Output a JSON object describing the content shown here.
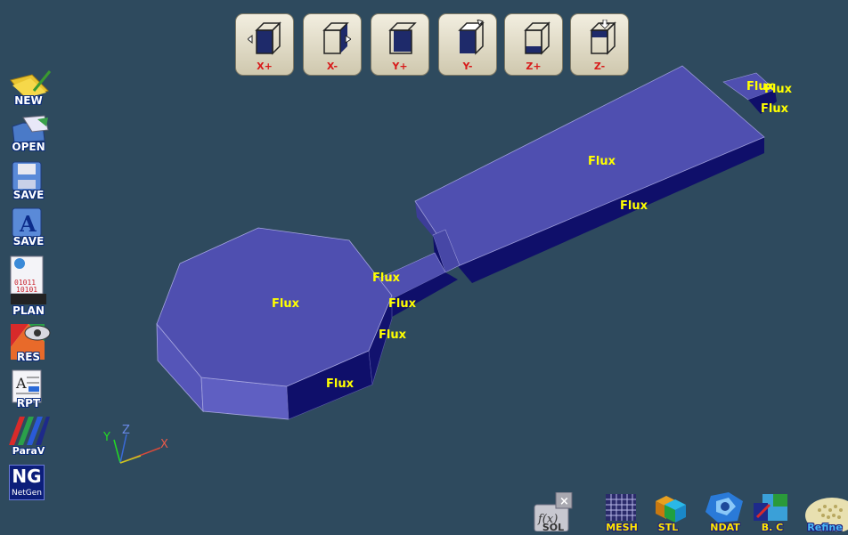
{
  "view_buttons": [
    {
      "label": "X+"
    },
    {
      "label": "X-"
    },
    {
      "label": "Y+"
    },
    {
      "label": "Y-"
    },
    {
      "label": "Z+"
    },
    {
      "label": "Z-"
    }
  ],
  "left_toolbar": [
    {
      "label": "NEW",
      "icon": "new-folder-icon"
    },
    {
      "label": "OPEN",
      "icon": "open-folder-icon"
    },
    {
      "label": "SAVE",
      "icon": "save-icon"
    },
    {
      "label": "SAVE",
      "icon": "save-as-icon"
    },
    {
      "label": "PLAN",
      "icon": "plan-icon"
    },
    {
      "label": "RES",
      "icon": "results-icon"
    },
    {
      "label": "RPT",
      "icon": "report-icon"
    },
    {
      "label": "ParaV",
      "icon": "paraview-icon"
    },
    {
      "label": "NG",
      "sublabel": "NetGen",
      "icon": "netgen-icon"
    }
  ],
  "bottom_toolbar": [
    {
      "label": "SOL",
      "icon": "solver-icon"
    },
    {
      "label": "MESH",
      "icon": "mesh-icon"
    },
    {
      "label": "STL",
      "icon": "stl-icon"
    },
    {
      "label": "NDAT",
      "icon": "ndat-icon"
    },
    {
      "label": "B. C",
      "icon": "boundary-conditions-icon"
    },
    {
      "label": "Refine",
      "icon": "refine-icon"
    }
  ],
  "scene": {
    "face_labels": [
      "Flux",
      "Flux",
      "Flux",
      "Flux",
      "Flux",
      "Flux",
      "Flux",
      "Flux",
      "Flux",
      "Flux"
    ],
    "axes": {
      "x": "X",
      "y": "Y",
      "z": "Z"
    }
  },
  "colors": {
    "background": "#2e4a5e",
    "face_light": "#4f4fb0",
    "face_dark": "#0f0f6a",
    "label": "#ffff00"
  }
}
